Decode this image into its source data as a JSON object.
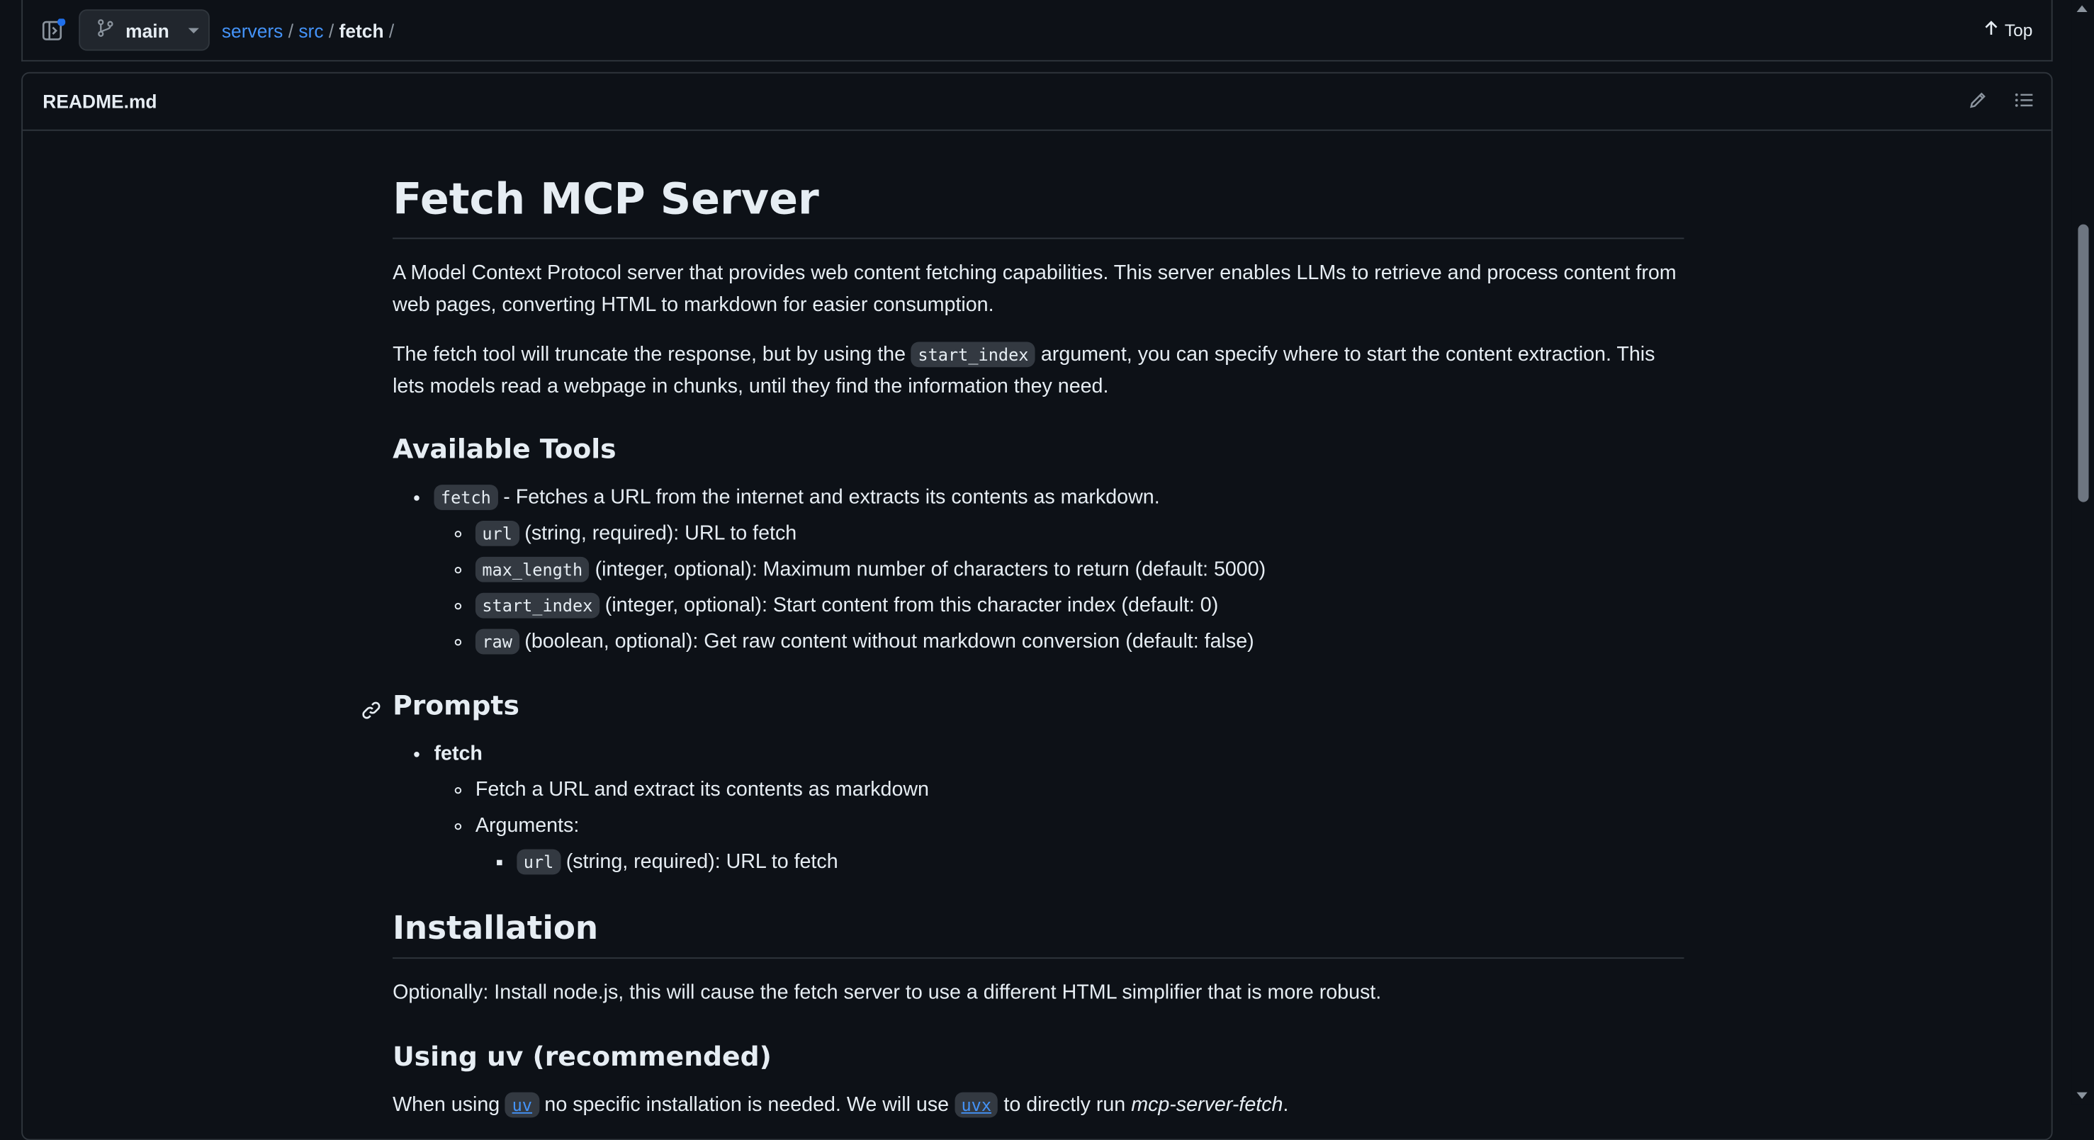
{
  "topbar": {
    "branch": "main",
    "breadcrumbs": [
      "servers",
      "src",
      "fetch"
    ],
    "sep": "/",
    "top_label": "Top"
  },
  "readme": {
    "filename": "README.md",
    "title": "Fetch MCP Server",
    "intro": "A Model Context Protocol server that provides web content fetching capabilities. This server enables LLMs to retrieve and process content from web pages, converting HTML to markdown for easier consumption.",
    "p2_a": "The fetch tool will truncate the response, but by using the",
    "p2_code": "start_index",
    "p2_b": "argument, you can specify where to start the content extraction. This lets models read a webpage in chunks, until they find the information they need.",
    "tools_heading": "Available Tools",
    "tool_name": "fetch",
    "tool_desc": "- Fetches a URL from the internet and extracts its contents as markdown.",
    "params": [
      {
        "code": "url",
        "desc": "(string, required): URL to fetch"
      },
      {
        "code": "max_length",
        "desc": "(integer, optional): Maximum number of characters to return (default: 5000)"
      },
      {
        "code": "start_index",
        "desc": "(integer, optional): Start content from this character index (default: 0)"
      },
      {
        "code": "raw",
        "desc": "(boolean, optional): Get raw content without markdown conversion (default: false)"
      }
    ],
    "prompts_heading": "Prompts",
    "prompt_name": "fetch",
    "prompt_desc": "Fetch a URL and extract its contents as markdown",
    "prompt_args_label": "Arguments:",
    "prompt_arg_code": "url",
    "prompt_arg_desc": "(string, required): URL to fetch",
    "install_heading": "Installation",
    "install_text": "Optionally: Install node.js, this will cause the fetch server to use a different HTML simplifier that is more robust.",
    "uv_heading": "Using uv (recommended)",
    "uv_a": "When using",
    "uv_code1": "uv",
    "uv_b": "no specific installation is needed. We will use",
    "uv_code2": "uvx",
    "uv_c": "to directly run",
    "uv_em": "mcp-server-fetch",
    "uv_d": "."
  }
}
